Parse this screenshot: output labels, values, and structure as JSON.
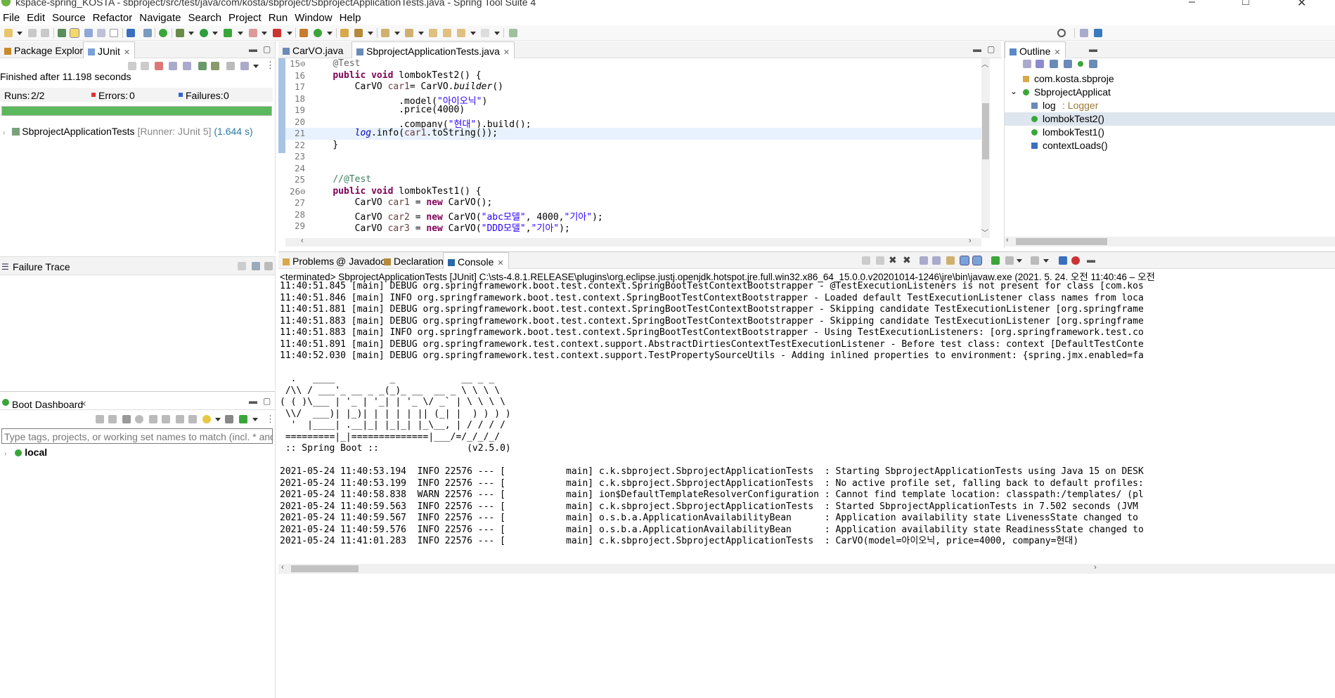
{
  "window": {
    "title": "kspace-spring_KOSTA - sbproject/src/test/java/com/kosta/sbproject/SbprojectApplicationTests.java - Spring Tool Suite 4",
    "controls": [
      "–",
      "□",
      "✕"
    ]
  },
  "menu": [
    "File",
    "Edit",
    "Source",
    "Refactor",
    "Navigate",
    "Search",
    "Project",
    "Run",
    "Window",
    "Help"
  ],
  "left": {
    "tabs": [
      "Package Explorer",
      "JUnit"
    ],
    "junit": {
      "finished": "Finished after 11.198 seconds",
      "runs_label": "Runs:",
      "runs_value": "2/2",
      "errors_label": "Errors:",
      "errors_value": "0",
      "failures_label": "Failures:",
      "failures_value": "0",
      "progress": 1.0,
      "progress_color": "#5cb85c",
      "tree_item": "SbprojectApplicationTests",
      "tree_runner": "[Runner: JUnit 5]",
      "tree_time": "(1.644 s)"
    },
    "failure_trace_title": "Failure Trace",
    "boot": {
      "title": "Boot Dashboard",
      "filter_placeholder": "Type tags, projects, or working set names to match (incl. * and ? wil",
      "item": "local"
    }
  },
  "editor": {
    "tabs": [
      "CarVO.java",
      "SbprojectApplicationTests.java"
    ],
    "active_tab": 1
  },
  "outline": {
    "title": "Outline",
    "items": [
      {
        "label": "com.kosta.sbproje",
        "type": "package"
      },
      {
        "label": "SbprojectApplicat",
        "type": "class"
      },
      {
        "label": "log",
        "suffix": ": Logger",
        "type": "field"
      },
      {
        "label": "lombokTest2()",
        "type": "method"
      },
      {
        "label": "lombokTest1()",
        "type": "method"
      },
      {
        "label": "contextLoads()",
        "type": "method"
      }
    ]
  },
  "bottom": {
    "tabs": [
      "Problems",
      "Javadoc",
      "Declaration",
      "Console"
    ],
    "active_tab": 3,
    "console_header": "<terminated> SbprojectApplicationTests [JUnit] C:\\sts-4.8.1.RELEASE\\plugins\\org.eclipse.justj.openjdk.hotspot.jre.full.win32.x86_64_15.0.0.v20201014-1246\\jre\\bin\\javaw.exe  (2021. 5. 24. 오전 11:40:46 – 오전",
    "lines": [
      "11:40:51.845 [main] DEBUG org.springframework.boot.test.context.SpringBootTestContextBootstrapper - @TestExecutionListeners is not present for class [com.kos",
      "11:40:51.846 [main] INFO org.springframework.boot.test.context.SpringBootTestContextBootstrapper - Loaded default TestExecutionListener class names from loca",
      "11:40:51.881 [main] DEBUG org.springframework.boot.test.context.SpringBootTestContextBootstrapper - Skipping candidate TestExecutionListener [org.springframe",
      "11:40:51.883 [main] DEBUG org.springframework.boot.test.context.SpringBootTestContextBootstrapper - Skipping candidate TestExecutionListener [org.springframe",
      "11:40:51.883 [main] INFO org.springframework.boot.test.context.SpringBootTestContextBootstrapper - Using TestExecutionListeners: [org.springframework.test.co",
      "11:40:51.891 [main] DEBUG org.springframework.test.context.support.AbstractDirtiesContextTestExecutionListener - Before test class: context [DefaultTestConte",
      "11:40:52.030 [main] DEBUG org.springframework.test.context.support.TestPropertySourceUtils - Adding inlined properties to environment: {spring.jmx.enabled=fa",
      "",
      "  .   ____          _            __ _ _",
      " /\\\\ / ___'_ __ _ _(_)_ __  __ _ \\ \\ \\ \\",
      "( ( )\\___ | '_ | '_| | '_ \\/ _` | \\ \\ \\ \\",
      " \\\\/  ___)| |_)| | | | | || (_| |  ) ) ) )",
      "  '  |____| .__|_| |_|_| |_\\__, | / / / /",
      " =========|_|==============|___/=/_/_/_/",
      " :: Spring Boot ::                (v2.5.0)",
      "",
      "2021-05-24 11:40:53.194  INFO 22576 --- [           main] c.k.sbproject.SbprojectApplicationTests  : Starting SbprojectApplicationTests using Java 15 on DESK",
      "2021-05-24 11:40:53.199  INFO 22576 --- [           main] c.k.sbproject.SbprojectApplicationTests  : No active profile set, falling back to default profiles:",
      "2021-05-24 11:40:58.838  WARN 22576 --- [           main] ion$DefaultTemplateResolverConfiguration : Cannot find template location: classpath:/templates/ (pl",
      "2021-05-24 11:40:59.563  INFO 22576 --- [           main] c.k.sbproject.SbprojectApplicationTests  : Started SbprojectApplicationTests in 7.502 seconds (JVM",
      "2021-05-24 11:40:59.567  INFO 22576 --- [           main] o.s.b.a.ApplicationAvailabilityBean      : Application availability state LivenessState changed to",
      "2021-05-24 11:40:59.576  INFO 22576 --- [           main] o.s.b.a.ApplicationAvailabilityBean      : Application availability state ReadinessState changed to",
      "2021-05-24 11:41:01.283  INFO 22576 --- [           main] c.k.sbproject.SbprojectApplicationTests  : CarVO(model=아이오닉, price=4000, company=현대)"
    ]
  },
  "code": [
    {
      "n": "15",
      "fold": true,
      "html": "    <span class='ann'>@Test</span>"
    },
    {
      "n": "16",
      "html": "    <span class='kw'>public void</span> lombokTest2() {"
    },
    {
      "n": "17",
      "html": "        CarVO <span class='var'>car1</span>= CarVO.<i>builder</i>()"
    },
    {
      "n": "18",
      "html": "                .model(<span class='str'>\"아이오닉\"</span>)"
    },
    {
      "n": "19",
      "html": "                .price(4000)"
    },
    {
      "n": "20",
      "html": "                .company(<span class='str'>\"현대\"</span>).build();"
    },
    {
      "n": "21",
      "current": true,
      "html": "        <span class='fld'>log</span>.info(<span class='var'>car1</span>.toString());"
    },
    {
      "n": "22",
      "html": "    }"
    },
    {
      "n": "23",
      "html": ""
    },
    {
      "n": "24",
      "html": ""
    },
    {
      "n": "25",
      "html": "    <span class='cmt'>//@Test</span>"
    },
    {
      "n": "26",
      "fold": true,
      "html": "    <span class='kw'>public void</span> lombokTest1() {"
    },
    {
      "n": "27",
      "html": "        CarVO <span class='var'>car1</span> = <span class='kw'>new</span> CarVO();"
    },
    {
      "n": "28",
      "html": "        CarVO <span class='var'>car2</span> = <span class='kw'>new</span> CarVO(<span class='str'>\"abc모델\"</span>, 4000,<span class='str'>\"기아\"</span>);"
    },
    {
      "n": "29",
      "html": "        CarVO <span class='var'>car3</span> = <span class='kw'>new</span> CarVO(<span class='str'>\"DDD모델\"</span>,<span class='str'>\"기아\"</span>);"
    }
  ]
}
